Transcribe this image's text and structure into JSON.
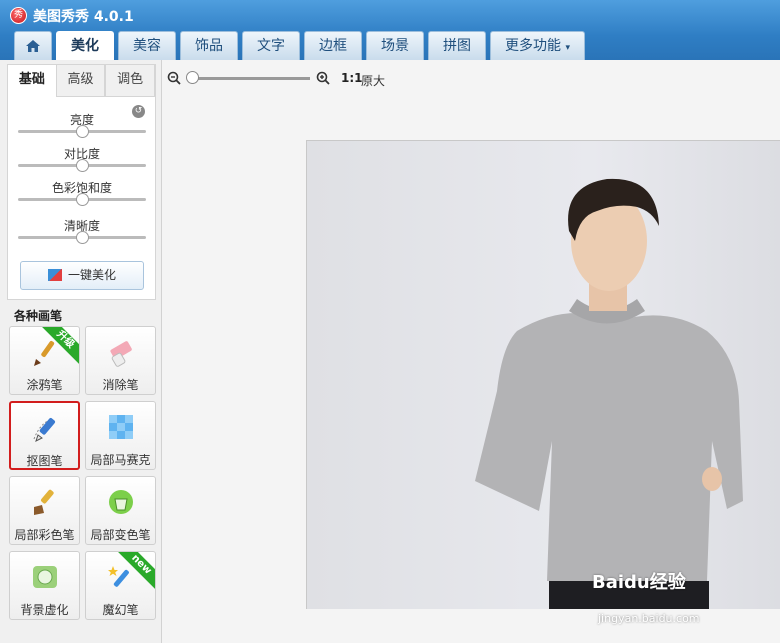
{
  "app": {
    "title": "美图秀秀 4.0.1",
    "logo_text": "秀"
  },
  "tabs": [
    {
      "label": "",
      "icon": "home-icon"
    },
    {
      "label": "美化",
      "active": true
    },
    {
      "label": "美容"
    },
    {
      "label": "饰品"
    },
    {
      "label": "文字"
    },
    {
      "label": "边框"
    },
    {
      "label": "场景"
    },
    {
      "label": "拼图"
    },
    {
      "label": "更多功能",
      "caret": "▾"
    }
  ],
  "adjust": {
    "subtabs": [
      {
        "label": "基础",
        "active": true
      },
      {
        "label": "高级"
      },
      {
        "label": "调色"
      }
    ],
    "sliders": [
      {
        "label": "亮度",
        "value_fraction": 0.5
      },
      {
        "label": "对比度",
        "value_fraction": 0.5
      },
      {
        "label": "色彩饱和度",
        "value_fraction": 0.5
      },
      {
        "label": "清晰度",
        "value_fraction": 0.5
      }
    ],
    "onekey_label": "一键美化"
  },
  "brushes": {
    "title": "各种画笔",
    "items": [
      {
        "label": "涂鸦笔",
        "icon": "paintbrush-icon",
        "badge": "升级"
      },
      {
        "label": "消除笔",
        "icon": "eraser-icon"
      },
      {
        "label": "抠图笔",
        "icon": "cutout-pen-icon",
        "selected": true
      },
      {
        "label": "局部马赛克",
        "icon": "mosaic-icon"
      },
      {
        "label": "局部彩色笔",
        "icon": "color-brush-icon"
      },
      {
        "label": "局部变色笔",
        "icon": "recolor-bucket-icon"
      },
      {
        "label": "背景虚化",
        "icon": "blur-background-icon"
      },
      {
        "label": "魔幻笔",
        "icon": "magic-wand-icon",
        "badge": "new"
      }
    ]
  },
  "zoom": {
    "ratio_label": "1:1",
    "original_label": "原大",
    "level_fraction": 0.0
  },
  "watermark": {
    "brand": "Baidu经验",
    "url": "jingyan.baidu.com"
  },
  "colors": {
    "accent": "#2f7ec4",
    "selected_border": "#d21d1d",
    "badge_green": "#2aa92a"
  }
}
